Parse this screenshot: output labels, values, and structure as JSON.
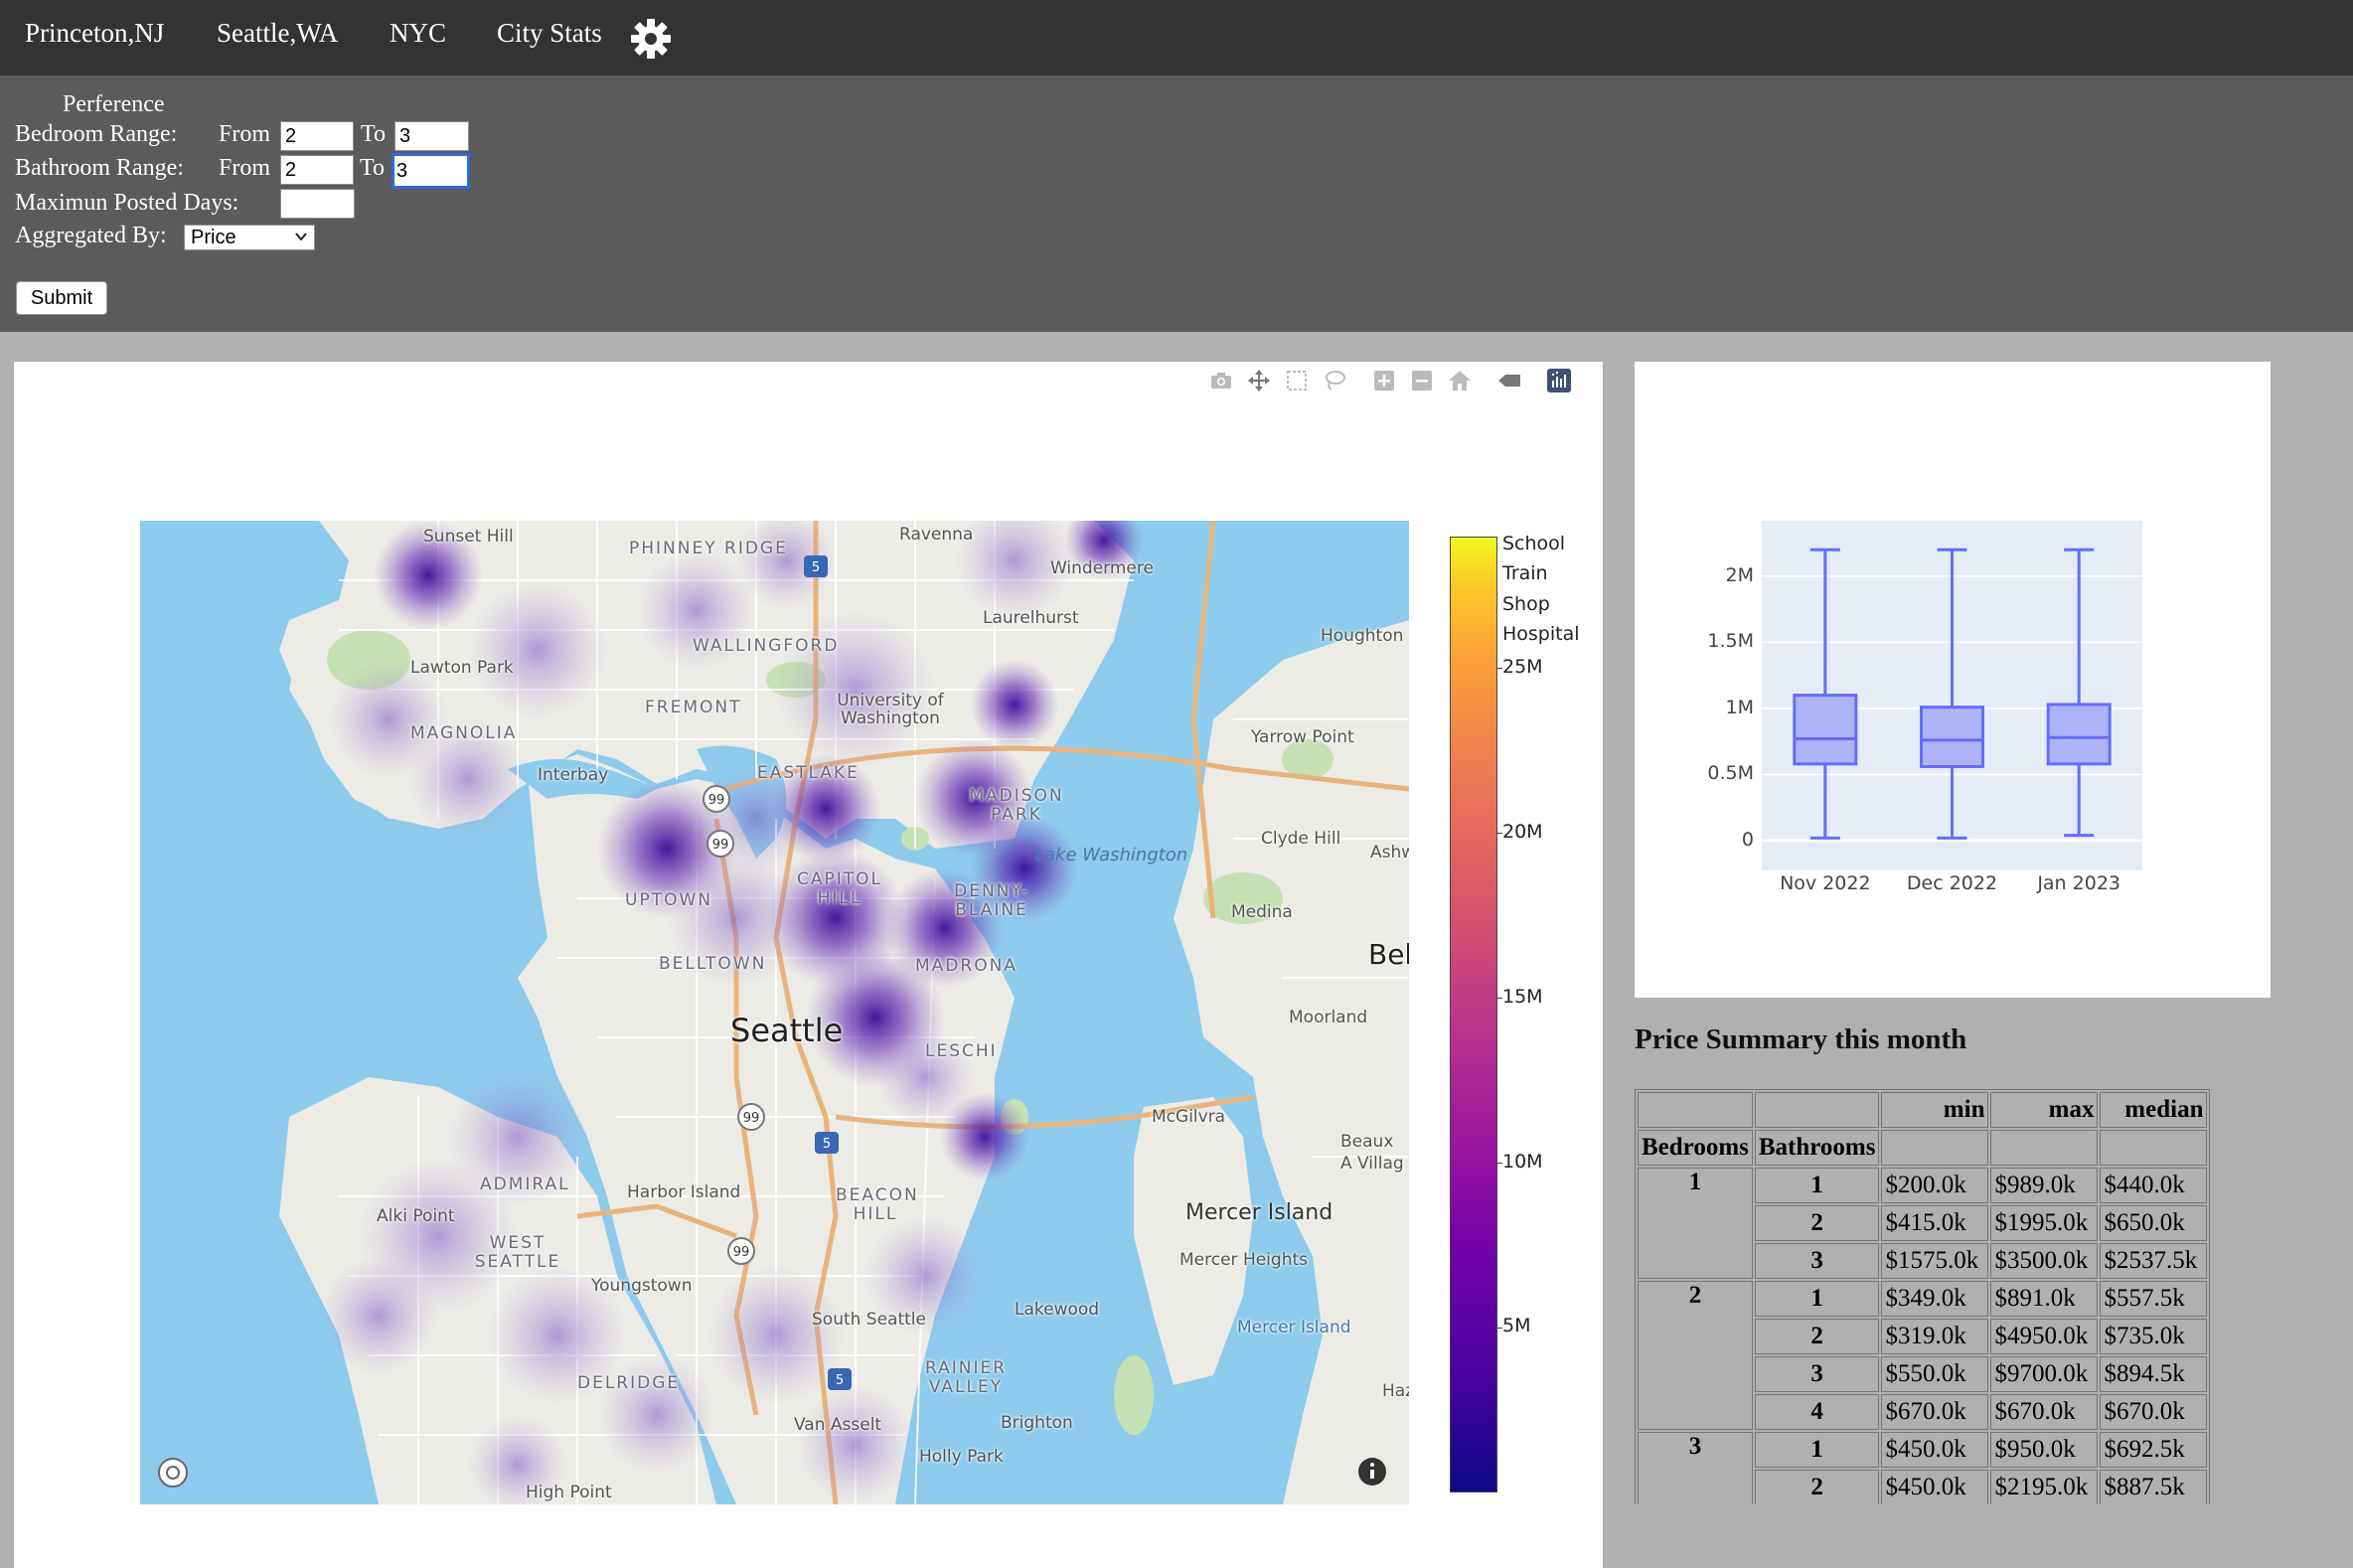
{
  "nav": {
    "items": [
      "Princeton,NJ",
      "Seattle,WA",
      "NYC",
      "City Stats"
    ],
    "settings_icon": "gear-icon"
  },
  "preferences": {
    "title": "Perference",
    "bedroom_label": "Bedroom Range:",
    "bathroom_label": "Bathroom Range:",
    "max_days_label": "Maximun Posted Days:",
    "aggregated_label": "Aggregated By:",
    "from_label": "From",
    "to_label": "To",
    "bedroom_from": "2",
    "bedroom_to": "3",
    "bathroom_from": "2",
    "bathroom_to": "3",
    "max_days": "",
    "aggregated_by": "Price",
    "submit_label": "Submit"
  },
  "map": {
    "modebar_icons": [
      "camera-icon",
      "pan-icon",
      "box-select-icon",
      "lasso-select-icon",
      "zoom-in-icon",
      "zoom-out-icon",
      "reset-home-icon",
      "toggle-spike-icon",
      "plotly-logo-icon"
    ],
    "labels": {
      "city": "Seattle",
      "neighborhoods": [
        "Sunset Hill",
        "PHINNEY RIDGE",
        "Ravenna",
        "Windermere",
        "Laurelhurst",
        "WALLINGFORD",
        "Lawton Park",
        "FREMONT",
        "University of Washington",
        "MAGNOLIA",
        "Interbay",
        "EASTLAKE",
        "MADISON PARK",
        "UPTOWN",
        "CAPITOL HILL",
        "DENNY-BLAINE",
        "BELLTOWN",
        "MADRONA",
        "LESCHI",
        "Houghton",
        "Yarrow Point",
        "Clyde Hill",
        "Ashw",
        "Medina",
        "Bel",
        "Moorland",
        "McGilvra",
        "Beaux A Villag",
        "Mercer Island",
        "Mercer Heights",
        "ADMIRAL",
        "Harbor Island",
        "BEACON HILL",
        "Alki Point",
        "WEST SEATTLE",
        "Youngstown",
        "South Seattle",
        "Lakewood",
        "RAINIER VALLEY",
        "DELRIDGE",
        "Van Asselt",
        "Brighton",
        "Holly Park",
        "Haz",
        "High Point"
      ],
      "water": "Lake Washington",
      "mercer_island_small": "Mercer Island",
      "highway_shields": [
        "5",
        "99",
        "5",
        "99",
        "99",
        "5",
        "99"
      ]
    },
    "colorbar": {
      "categories": [
        "School",
        "Train",
        "Shop",
        "Hospital"
      ],
      "ticks": [
        "25M",
        "20M",
        "15M",
        "10M",
        "5M"
      ],
      "colorscale": [
        "#0d0887",
        "#46039f",
        "#7201a8",
        "#9c179e",
        "#bd3786",
        "#d8576b",
        "#ed7953",
        "#fb9f3a",
        "#fdca26",
        "#f0f921"
      ]
    }
  },
  "chart_data": {
    "type": "box",
    "categories": [
      "Nov 2022",
      "Dec 2022",
      "Jan 2023"
    ],
    "yticks": [
      "0",
      "0.5M",
      "1M",
      "1.5M",
      "2M"
    ],
    "ylim": [
      0,
      2.3
    ],
    "boxes": [
      {
        "label": "Nov 2022",
        "min": 0.02,
        "q1": 0.58,
        "median": 0.77,
        "q3": 1.1,
        "max": 2.2
      },
      {
        "label": "Dec 2022",
        "min": 0.02,
        "q1": 0.56,
        "median": 0.76,
        "q3": 1.01,
        "max": 2.2
      },
      {
        "label": "Jan 2023",
        "min": 0.04,
        "q1": 0.58,
        "median": 0.78,
        "q3": 1.03,
        "max": 2.2
      }
    ],
    "color": "#636efa"
  },
  "summary": {
    "title": "Price Summary this month",
    "headers": [
      "min",
      "max",
      "median"
    ],
    "row_headers": [
      "Bedrooms",
      "Bathrooms"
    ],
    "groups": [
      {
        "bedrooms": "1",
        "rows": [
          {
            "bathrooms": "1",
            "min": "$200.0k",
            "max": "$989.0k",
            "median": "$440.0k"
          },
          {
            "bathrooms": "2",
            "min": "$415.0k",
            "max": "$1995.0k",
            "median": "$650.0k"
          },
          {
            "bathrooms": "3",
            "min": "$1575.0k",
            "max": "$3500.0k",
            "median": "$2537.5k"
          }
        ]
      },
      {
        "bedrooms": "2",
        "rows": [
          {
            "bathrooms": "1",
            "min": "$349.0k",
            "max": "$891.0k",
            "median": "$557.5k"
          },
          {
            "bathrooms": "2",
            "min": "$319.0k",
            "max": "$4950.0k",
            "median": "$735.0k"
          },
          {
            "bathrooms": "3",
            "min": "$550.0k",
            "max": "$9700.0k",
            "median": "$894.5k"
          },
          {
            "bathrooms": "4",
            "min": "$670.0k",
            "max": "$670.0k",
            "median": "$670.0k"
          }
        ]
      },
      {
        "bedrooms": "3",
        "rows": [
          {
            "bathrooms": "1",
            "min": "$450.0k",
            "max": "$950.0k",
            "median": "$692.5k"
          },
          {
            "bathrooms": "2",
            "min": "$450.0k",
            "max": "$2195.0k",
            "median": "$887.5k"
          }
        ]
      }
    ]
  }
}
